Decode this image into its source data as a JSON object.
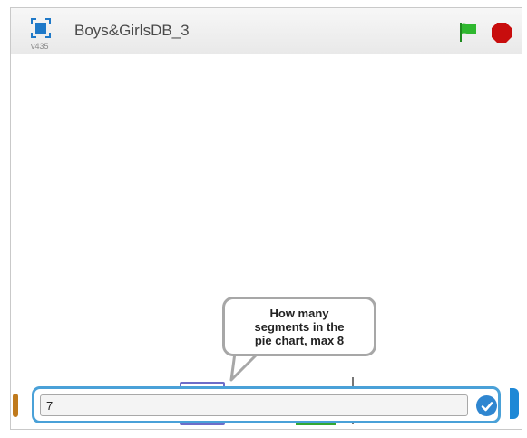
{
  "window": {
    "title": "Boys&GirlsDB_3",
    "version": "v435"
  },
  "controls": {
    "green_flag_icon": "green-flag-icon",
    "stop_icon": "stop-sign-icon",
    "present_icon": "fullscreen-icon"
  },
  "sprite_bubble": {
    "text": "How many\nsegments in the\npie chart, max 8"
  },
  "answer": {
    "value": "7",
    "submit_icon": "checkmark-icon"
  },
  "colors": {
    "accent": "#4aa1d8",
    "flag": "#2fb82f",
    "stop": "#c80d0d",
    "bubble_border": "#a7a7a7"
  }
}
